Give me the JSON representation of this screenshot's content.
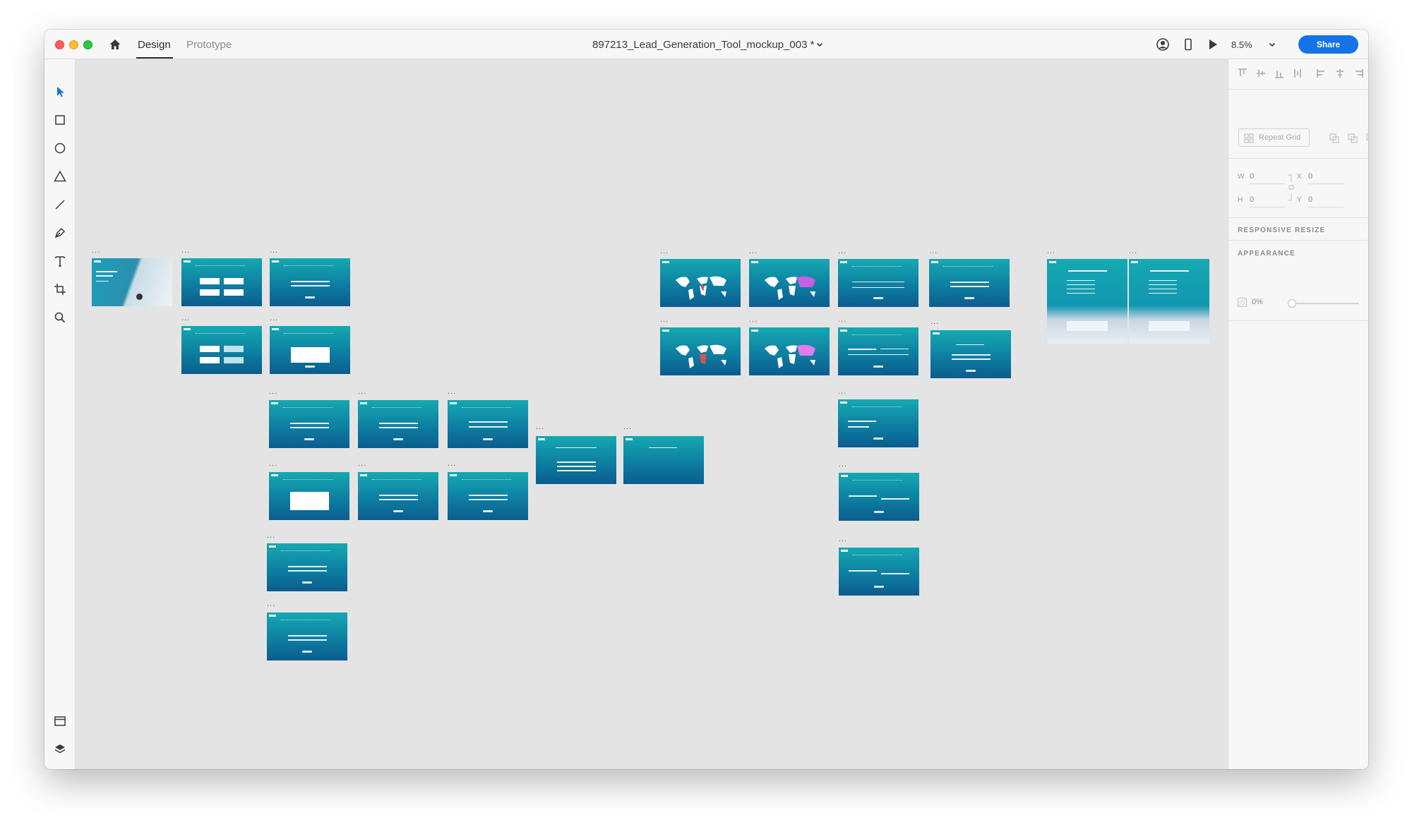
{
  "titlebar": {
    "tabs": [
      "Design",
      "Prototype"
    ],
    "doc_title": "897213_Lead_Generation_Tool_mockup_003 *",
    "zoom": "8.5%",
    "share_label": "Share"
  },
  "canvas": {
    "artboard_label": "..."
  },
  "panel": {
    "repeat_grid_label": "Repeat Grid",
    "w_label": "W",
    "w_value": "0",
    "h_label": "H",
    "h_value": "0",
    "x_label": "X",
    "x_value": "0",
    "y_label": "Y",
    "y_value": "0",
    "responsive_resize_label": "RESPONSIVE RESIZE",
    "appearance_label": "APPEARANCE",
    "opacity_value": "0%"
  },
  "colors": {
    "accent": "#1473e6",
    "artboard_top": "#15a9b1",
    "artboard_bottom": "#0b5c8e"
  }
}
